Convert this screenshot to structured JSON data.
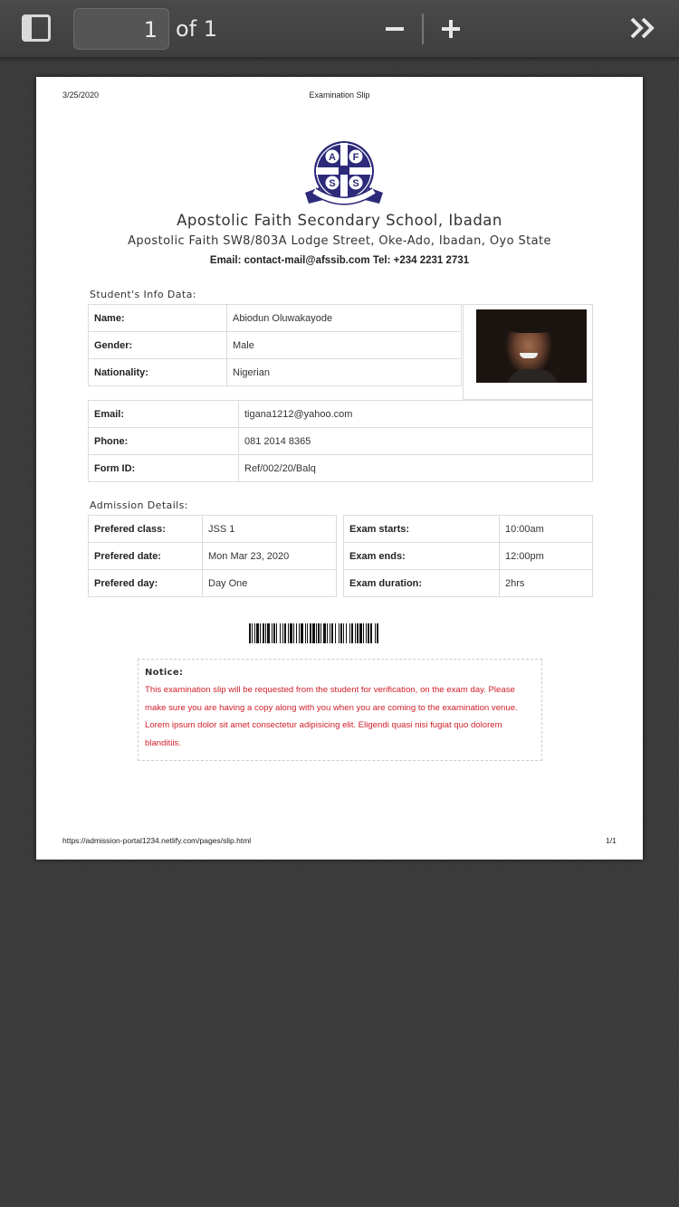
{
  "toolbar": {
    "current_page": "1",
    "page_of": "of 1"
  },
  "page_header": {
    "date": "3/25/2020",
    "title": "Examination Slip"
  },
  "logo": {
    "letters": [
      "A",
      "F",
      "S",
      "S"
    ],
    "motto": "LET THE LIGHT SHINE"
  },
  "school": {
    "name": "Apostolic Faith Secondary School, Ibadan",
    "address": "Apostolic Faith SW8/803A Lodge Street, Oke-Ado, Ibadan, Oyo State",
    "contact": "Email: contact-mail@afssib.com Tel: +234 2231 2731"
  },
  "student_info": {
    "title": "Student's Info Data:",
    "name_label": "Name:",
    "name": "Abiodun Oluwakayode",
    "gender_label": "Gender:",
    "gender": "Male",
    "nationality_label": "Nationality:",
    "nationality": "Nigerian",
    "email_label": "Email:",
    "email": "tigana1212@yahoo.com",
    "phone_label": "Phone:",
    "phone": "081 2014 8365",
    "formid_label": "Form ID:",
    "formid": "Ref/002/20/Balq"
  },
  "admission": {
    "title": "Admission Details:",
    "class_label": "Prefered class:",
    "class": "JSS 1",
    "date_label": "Prefered date:",
    "date": "Mon Mar 23, 2020",
    "day_label": "Prefered day:",
    "day": "Day One",
    "starts_label": "Exam starts:",
    "starts": "10:00am",
    "ends_label": "Exam ends:",
    "ends": "12:00pm",
    "duration_label": "Exam duration:",
    "duration": "2hrs"
  },
  "notice": {
    "title": "Notice:",
    "text": "This examination slip will be requested from the student for verification, on the exam day. Please make sure you are having a copy along with you when you are coming to the examination venue. Lorem ipsum dolor sit amet consectetur adipisicing elit. Eligendi quasi nisi fugiat quo dolorem blanditiis."
  },
  "page_footer": {
    "url": "https://admission-portal1234.netlify.com/pages/slip.html",
    "page": "1/1"
  },
  "colors": {
    "toolbar": "#444444",
    "viewer_bg": "#3b3b3b",
    "logo_blue": "#2d2a7a",
    "notice_red": "#d0202a"
  },
  "icons": [
    "sidebar-toggle-icon",
    "zoom-out-icon",
    "zoom-in-icon",
    "double-chevron-right-icon"
  ]
}
